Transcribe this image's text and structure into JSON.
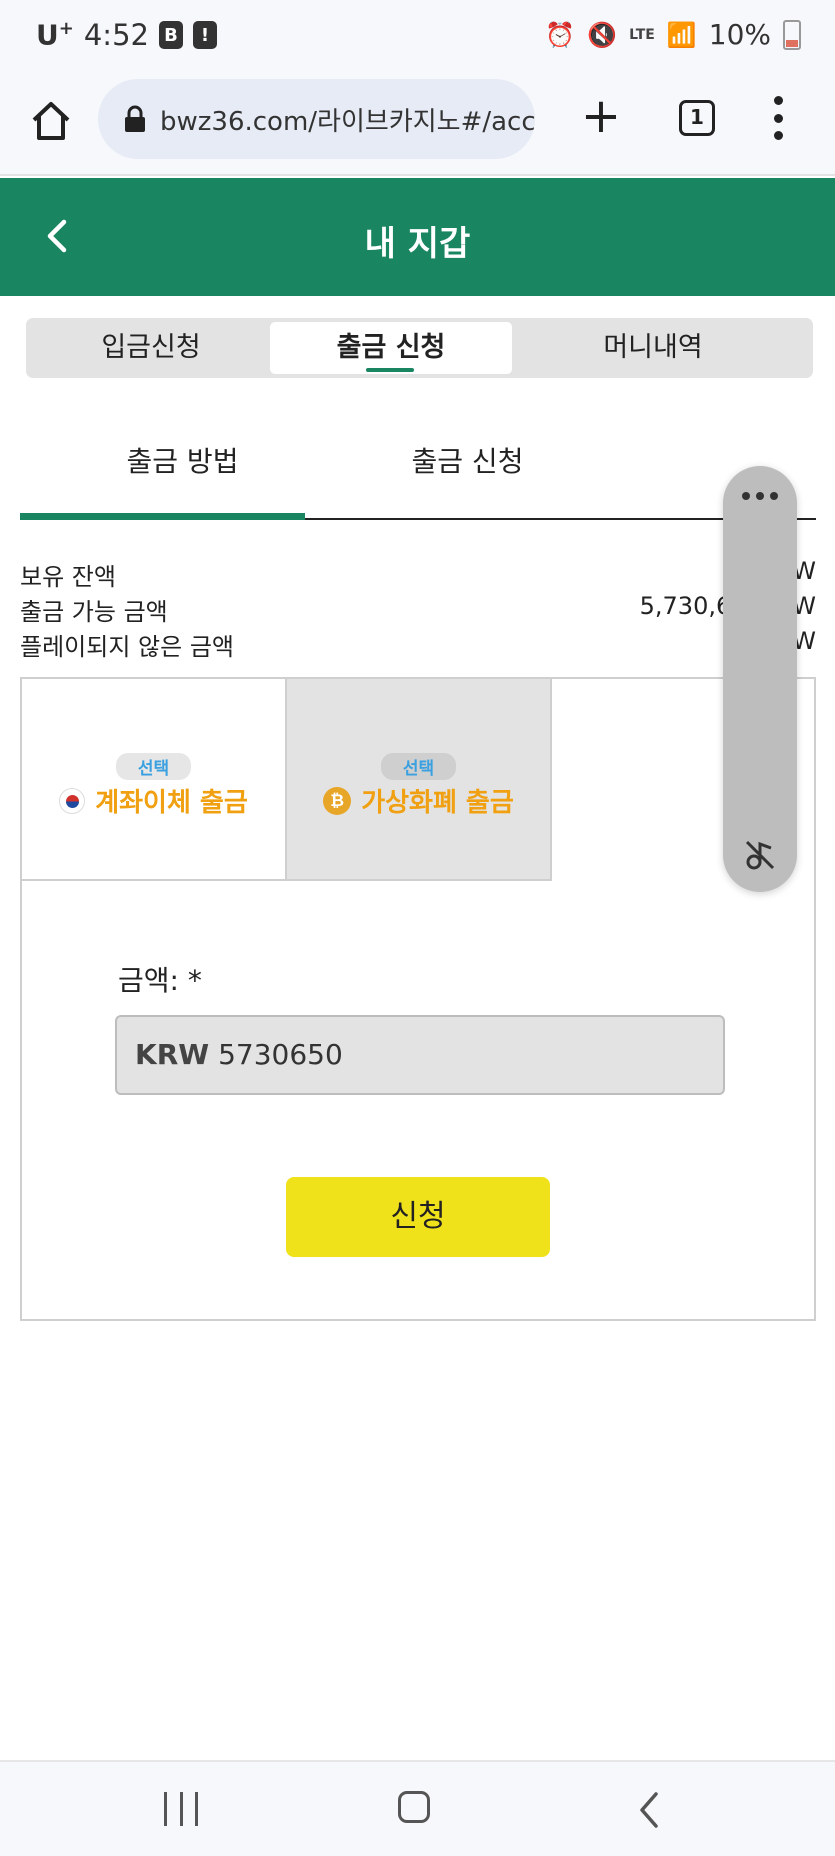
{
  "status_bar": {
    "carrier": "U",
    "carrier_sup": "+",
    "time": "4:52",
    "badge_b": "B",
    "badge_alert": "!",
    "network": "LTE",
    "battery": "10%"
  },
  "browser": {
    "url": "bwz36.com/라이브카지노#/acc",
    "tab_count": "1"
  },
  "header": {
    "title": "내 지갑"
  },
  "seg_tabs": [
    {
      "label": "입금신청"
    },
    {
      "label": "출금 신청"
    },
    {
      "label": "머니내역"
    }
  ],
  "sub_tabs": [
    {
      "label": "출금 방법"
    },
    {
      "label": "출금 신청"
    }
  ],
  "balances": [
    {
      "label": "보유 잔액",
      "value": "W"
    },
    {
      "label": "출금 가능 금액",
      "value": "5,730,6        W"
    },
    {
      "label": "플레이되지 않은 금액",
      "value": "W"
    }
  ],
  "methods": [
    {
      "badge": "선택",
      "label": "계좌이체 출금"
    },
    {
      "badge": "선택",
      "label": "가상화폐 출금"
    }
  ],
  "form": {
    "amount_label": "금액: *",
    "currency": "KRW",
    "amount_value": "5730650",
    "submit_label": "신청"
  },
  "colors": {
    "brand_green": "#198561",
    "submit_yellow": "#f0e21a",
    "method_label_orange": "#f0a010",
    "badge_blue": "#3aa0e0"
  }
}
